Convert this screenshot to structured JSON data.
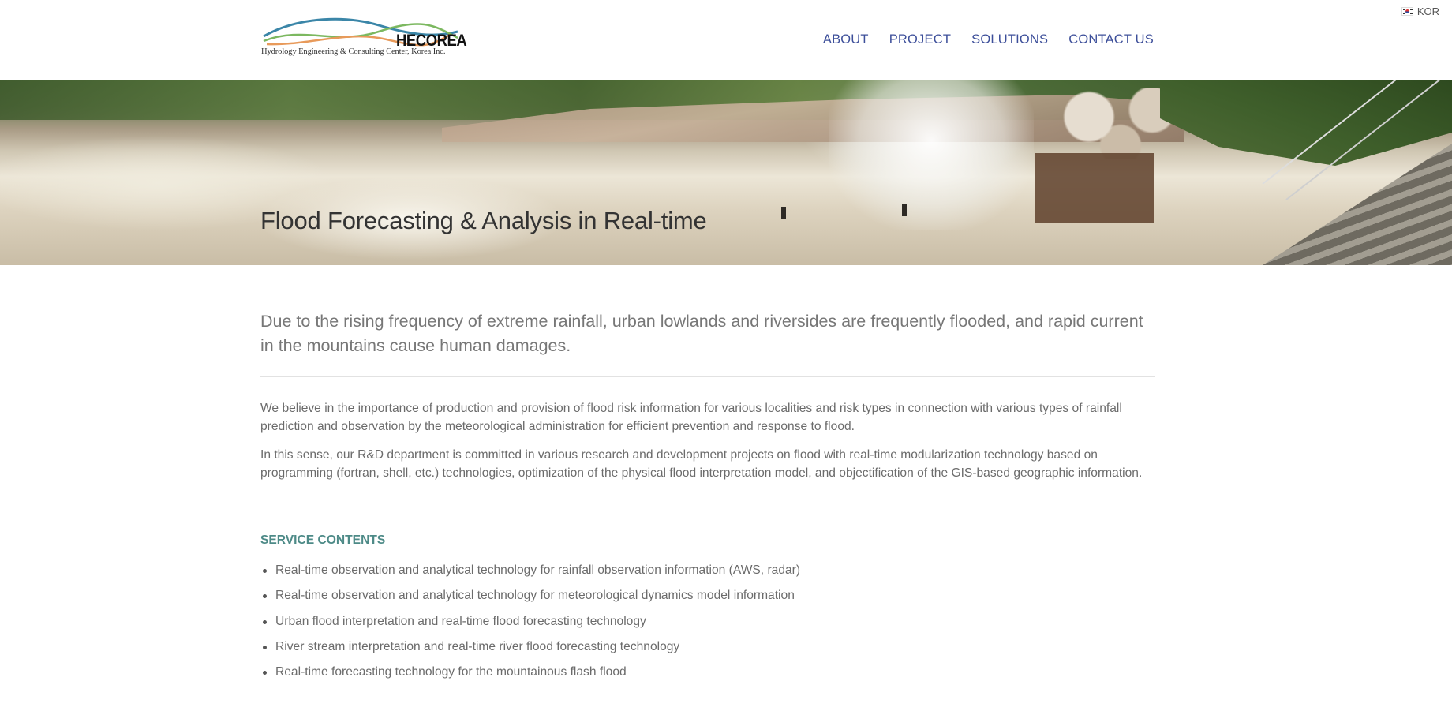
{
  "lang": {
    "label": "KOR",
    "icon": "korea-flag-icon"
  },
  "logo": {
    "name": "HECOREA",
    "subtitle": "Hydrology Engineering & Consulting Center, Korea Inc.",
    "colors": {
      "blue": "#3b86a8",
      "green": "#7cb860",
      "orange": "#e89a5a"
    }
  },
  "nav": {
    "items": [
      {
        "label": "ABOUT"
      },
      {
        "label": "PROJECT"
      },
      {
        "label": "SOLUTIONS"
      },
      {
        "label": "CONTACT US"
      }
    ],
    "color": "#3d4f9a"
  },
  "hero": {
    "title": "Flood Forecasting & Analysis in Real-time"
  },
  "content": {
    "intro": "Due to the rising frequency of extreme rainfall, urban lowlands and riversides are frequently flooded, and rapid current in the mountains cause human damages.",
    "paragraph1": "We believe in the importance of production and provision of flood risk information for various localities and risk types in connection with various types of rainfall prediction and observation by the meteorological administration for efficient prevention and response to flood.",
    "paragraph2": "In this sense, our R&D department is committed in various research and development projects on flood with real-time modularization technology based on programming (fortran, shell, etc.) technologies, optimization of the physical flood interpretation model, and objectification of the GIS-based geographic information.",
    "service_title": "SERVICE CONTENTS",
    "service_color": "#4d8a87",
    "services": [
      "Real-time observation and analytical technology for rainfall observation information (AWS, radar)",
      "Real-time observation and analytical technology for meteorological dynamics model information",
      "Urban flood interpretation and real-time flood forecasting technology",
      "River stream interpretation and real-time river flood forecasting technology",
      "Real-time forecasting technology for the mountainous flash flood"
    ]
  }
}
